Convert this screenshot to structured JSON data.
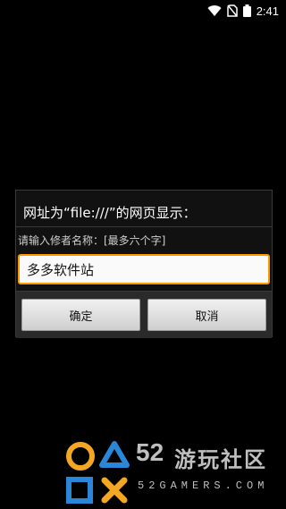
{
  "status_bar": {
    "time": "2:41",
    "icons": [
      "wifi-icon",
      "no-sim-icon",
      "battery-icon"
    ]
  },
  "dialog": {
    "title": "网址为“file:///”的网页显示：",
    "label": "请输入修者名称：[最多六个字]",
    "input_value": "多多软件站",
    "ok_label": "确定",
    "cancel_label": "取消",
    "accent_color": "#ff9800"
  },
  "watermark": {
    "number": "52",
    "chinese": "游玩社区",
    "english": "52GAMERS.COM",
    "colors": {
      "orange": "#f5a623",
      "blue": "#2a86d6",
      "gray": "#bfbfbf"
    }
  }
}
